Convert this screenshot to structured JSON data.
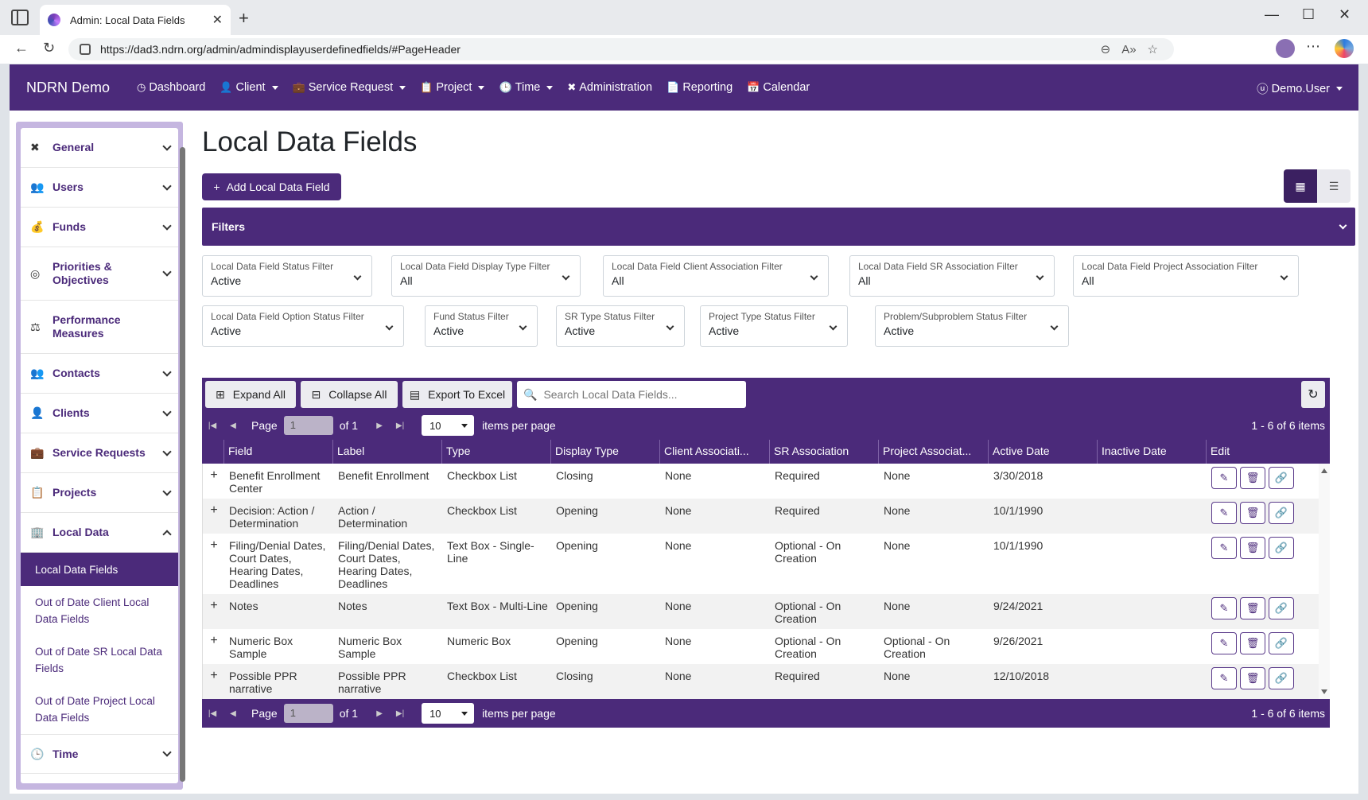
{
  "browser": {
    "tab_title": "Admin: Local Data Fields",
    "url": "https://dad3.ndrn.org/admin/admindisplayuserdefinedfields/#PageHeader"
  },
  "nav": {
    "brand": "NDRN Demo",
    "items": [
      {
        "label": "Dashboard",
        "icon": "dashboard-icon",
        "dropdown": false
      },
      {
        "label": "Client",
        "icon": "user-icon",
        "dropdown": true
      },
      {
        "label": "Service Request",
        "icon": "briefcase-icon",
        "dropdown": true
      },
      {
        "label": "Project",
        "icon": "clipboard-icon",
        "dropdown": true
      },
      {
        "label": "Time",
        "icon": "clock-icon",
        "dropdown": true
      },
      {
        "label": "Administration",
        "icon": "tools-icon",
        "dropdown": false
      },
      {
        "label": "Reporting",
        "icon": "file-icon",
        "dropdown": false
      },
      {
        "label": "Calendar",
        "icon": "calendar-icon",
        "dropdown": false
      }
    ],
    "user": "Demo.User"
  },
  "sidebar": {
    "items": [
      {
        "label": "General",
        "icon": "tools-icon",
        "expanded": false
      },
      {
        "label": "Users",
        "icon": "users-icon",
        "expanded": false
      },
      {
        "label": "Funds",
        "icon": "money-bag-icon",
        "expanded": false
      },
      {
        "label": "Priorities & Objectives",
        "icon": "target-icon",
        "expanded": false
      },
      {
        "label": "Performance Measures",
        "icon": "scale-icon",
        "expanded": false
      },
      {
        "label": "Contacts",
        "icon": "contacts-icon",
        "expanded": false
      },
      {
        "label": "Clients",
        "icon": "user-icon",
        "expanded": false
      },
      {
        "label": "Service Requests",
        "icon": "briefcase-icon",
        "expanded": false
      },
      {
        "label": "Projects",
        "icon": "clipboard-icon",
        "expanded": false
      },
      {
        "label": "Local Data",
        "icon": "building-icon",
        "expanded": true
      },
      {
        "label": "Time",
        "icon": "clock-icon",
        "expanded": false
      }
    ],
    "local_data_sub": [
      {
        "label": "Local Data Fields",
        "active": true
      },
      {
        "label": "Out of Date Client Local Data Fields",
        "active": false
      },
      {
        "label": "Out of Date SR Local Data Fields",
        "active": false
      },
      {
        "label": "Out of Date Project Local Data Fields",
        "active": false
      }
    ]
  },
  "main": {
    "title": "Local Data Fields",
    "add_button": "Add Local Data Field",
    "filters_label": "Filters",
    "filters": [
      {
        "label": "Local Data Field Status Filter",
        "value": "Active"
      },
      {
        "label": "Local Data Field Display Type Filter",
        "value": "All"
      },
      {
        "label": "Local Data Field Client Association Filter",
        "value": "All"
      },
      {
        "label": "Local Data Field SR Association Filter",
        "value": "All"
      },
      {
        "label": "Local Data Field Project Association Filter",
        "value": "All"
      },
      {
        "label": "Local Data Field Option Status Filter",
        "value": "Active"
      },
      {
        "label": "Fund Status Filter",
        "value": "Active"
      },
      {
        "label": "SR Type Status Filter",
        "value": "Active"
      },
      {
        "label": "Project Type Status Filter",
        "value": "Active"
      },
      {
        "label": "Problem/Subproblem Status Filter",
        "value": "Active"
      }
    ]
  },
  "grid": {
    "expand_all": "Expand All",
    "collapse_all": "Collapse All",
    "export": "Export To Excel",
    "search_placeholder": "Search Local Data Fields...",
    "pager": {
      "page_label": "Page",
      "page_value": "1",
      "of_label": "of 1",
      "per_page_value": "10",
      "per_page_label": "items per page",
      "count": "1 - 6 of 6 items"
    },
    "columns": [
      "Field",
      "Label",
      "Type",
      "Display Type",
      "Client Associati...",
      "SR Association",
      "Project Associat...",
      "Active Date",
      "Inactive Date",
      "Edit"
    ],
    "rows": [
      {
        "field": "Benefit Enrollment Center",
        "label": "Benefit Enrollment",
        "type": "Checkbox List",
        "display": "Closing",
        "client": "None",
        "sr": "Required",
        "project": "None",
        "active": "3/30/2018",
        "inactive": ""
      },
      {
        "field": "Decision: Action / Determination",
        "label": "Action / Determination",
        "type": "Checkbox List",
        "display": "Opening",
        "client": "None",
        "sr": "Required",
        "project": "None",
        "active": "10/1/1990",
        "inactive": ""
      },
      {
        "field": "Filing/Denial Dates, Court Dates, Hearing Dates, Deadlines",
        "label": "Filing/Denial Dates, Court Dates, Hearing Dates, Deadlines",
        "type": "Text Box - Single-Line",
        "display": "Opening",
        "client": "None",
        "sr": "Optional - On Creation",
        "project": "None",
        "active": "10/1/1990",
        "inactive": ""
      },
      {
        "field": "Notes",
        "label": "Notes",
        "type": "Text Box - Multi-Line",
        "display": "Opening",
        "client": "None",
        "sr": "Optional - On Creation",
        "project": "None",
        "active": "9/24/2021",
        "inactive": ""
      },
      {
        "field": "Numeric Box Sample",
        "label": "Numeric Box Sample",
        "type": "Numeric Box",
        "display": "Opening",
        "client": "None",
        "sr": "Optional - On Creation",
        "project": "Optional - On Creation",
        "active": "9/26/2021",
        "inactive": ""
      },
      {
        "field": "Possible PPR narrative",
        "label": "Possible PPR narrative",
        "type": "Checkbox List",
        "display": "Closing",
        "client": "None",
        "sr": "Required",
        "project": "None",
        "active": "12/10/2018",
        "inactive": ""
      }
    ]
  }
}
